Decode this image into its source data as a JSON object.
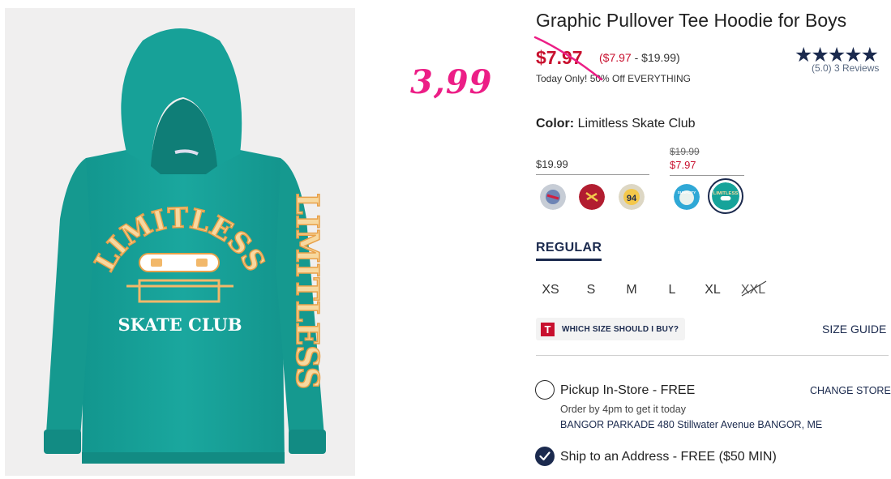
{
  "product": {
    "title": "Graphic Pullover Tee Hoodie for Boys",
    "sale_price": "$7.97",
    "range_low": "($7.97",
    "range_dash": " - ",
    "range_high": "$19.99)",
    "promo": "Today Only! 50% Off EVERYTHING",
    "handwritten_price": "3,99",
    "rating": {
      "value": 5.0,
      "stars": "★★★★★",
      "text": "(5.0) 3 Reviews"
    }
  },
  "image_text": {
    "arc": "LIMITLESS",
    "subtitle": "SKATE CLUB",
    "sleeve": "LIMITLESS"
  },
  "color": {
    "label": "Color:",
    "value": "Limitless Skate Club",
    "groups": [
      {
        "price": "$19.99",
        "swatches": [
          "swatch-1",
          "swatch-2",
          "swatch-3"
        ]
      },
      {
        "orig_price": "$19.99",
        "sale_price": "$7.97",
        "swatches": [
          "swatch-4",
          "swatch-5"
        ]
      }
    ],
    "swatch_texts": {
      "swatch_3": "94",
      "swatch_4": "SURFCITY",
      "swatch_5": "LIMITLESS"
    },
    "swatch_colors": [
      "#b8c3d2",
      "#b21d30",
      "#f4c84a",
      "#2fa8d6",
      "#16a39a"
    ]
  },
  "fit": {
    "tab": "REGULAR"
  },
  "sizes": [
    {
      "label": "XS",
      "available": true
    },
    {
      "label": "S",
      "available": true
    },
    {
      "label": "M",
      "available": true
    },
    {
      "label": "L",
      "available": true
    },
    {
      "label": "XL",
      "available": true
    },
    {
      "label": "XXL",
      "available": false
    }
  ],
  "size_help": {
    "icon_letter": "T",
    "label": "WHICH SIZE SHOULD I BUY?",
    "guide": "SIZE GUIDE"
  },
  "fulfillment": {
    "pickup": "Pickup In-Store - FREE",
    "change_store": "CHANGE STORE",
    "order_by": "Order by 4pm to get it today",
    "store": "BANGOR PARKADE 480 Stillwater Avenue  BANGOR, ME",
    "ship": "Ship to an Address - FREE ($50 MIN)"
  },
  "colors": {
    "navy": "#1b2a4e",
    "sale_red": "#c8102e",
    "pink": "#ec1e86",
    "teal": "#16a39a"
  }
}
